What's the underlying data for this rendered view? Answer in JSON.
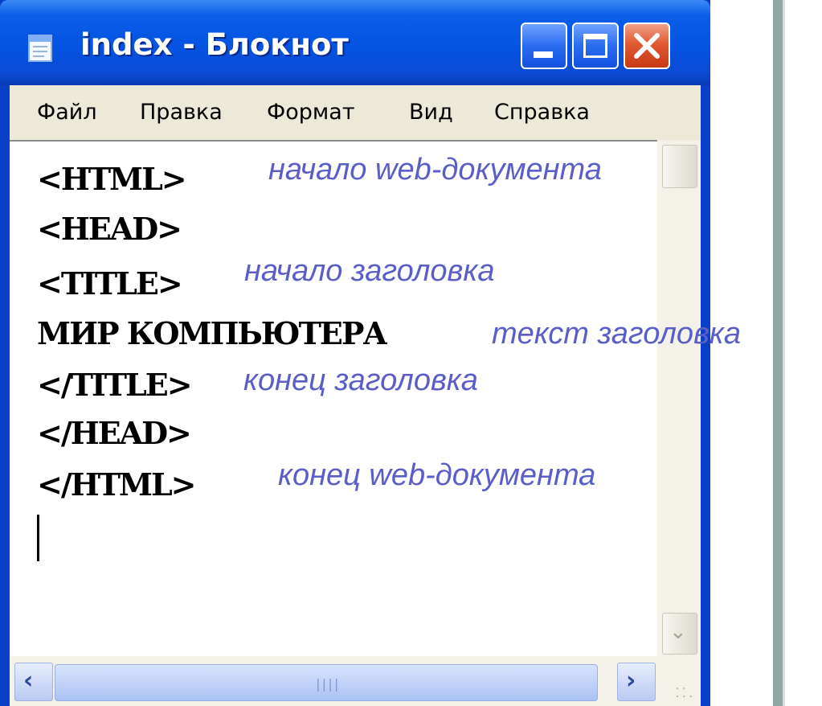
{
  "window": {
    "title": "index - Блокнот",
    "icon": "notepad-icon",
    "title_bar_color": "#0553e2",
    "close_button_color": "#e05a32"
  },
  "menu": {
    "items": [
      "Файл",
      "Правка",
      "Формат",
      "Вид",
      "Справка"
    ]
  },
  "editor": {
    "lines": [
      "<HTML>",
      "<HEAD>",
      "<TITLE>",
      "МИР КОМПЬЮТЕРА",
      "</TITLE>",
      "</HEAD>",
      "</HTML>"
    ],
    "annotations": {
      "html_open": "начало web-документа",
      "title_open": "начало заголовка",
      "title_text": "текст  заголовка",
      "title_close": "конец заголовка",
      "html_close": "конец web-документа"
    },
    "annotation_color": "#5a5ec9"
  }
}
